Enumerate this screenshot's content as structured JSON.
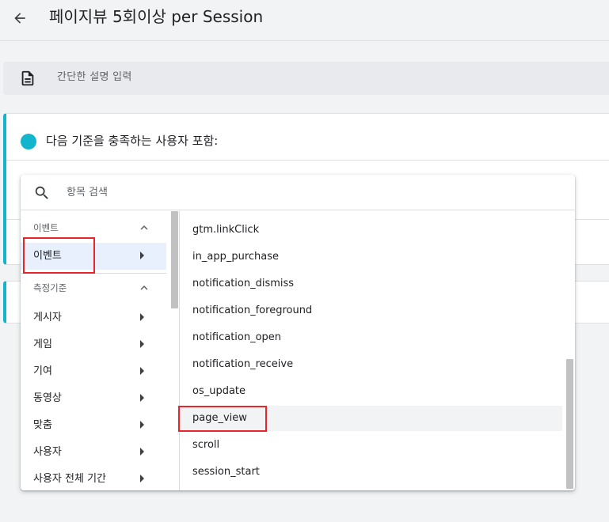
{
  "header": {
    "title": "페이지뷰 5회이상 per Session"
  },
  "description": {
    "placeholder": "간단한 설명 입력"
  },
  "condition": {
    "heading": "다음 기준을 충족하는 사용자 포함:"
  },
  "dropdown": {
    "search_placeholder": "항목 검색",
    "groups": [
      {
        "label": "이벤트"
      },
      {
        "label": "측정기준"
      }
    ],
    "event_items": [
      {
        "label": "이벤트"
      }
    ],
    "dimension_items": [
      {
        "label": "게시자"
      },
      {
        "label": "게임"
      },
      {
        "label": "기여"
      },
      {
        "label": "동영상"
      },
      {
        "label": "맞춤"
      },
      {
        "label": "사용자"
      },
      {
        "label": "사용자 전체 기간"
      }
    ],
    "events": [
      {
        "label": "gtm.linkClick"
      },
      {
        "label": "in_app_purchase"
      },
      {
        "label": "notification_dismiss"
      },
      {
        "label": "notification_foreground"
      },
      {
        "label": "notification_open"
      },
      {
        "label": "notification_receive"
      },
      {
        "label": "os_update"
      },
      {
        "label": "page_view"
      },
      {
        "label": "scroll"
      },
      {
        "label": "session_start"
      }
    ]
  },
  "colors": {
    "accent": "#12b5cb",
    "highlight": "#e8252b",
    "selected_bg": "#e8f0fe"
  }
}
